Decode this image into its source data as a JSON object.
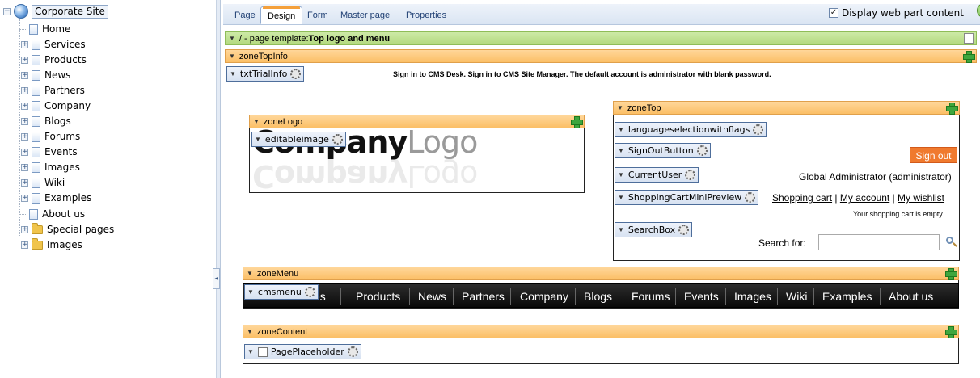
{
  "tree": {
    "root": "Corporate Site",
    "items": [
      {
        "label": "Home"
      },
      {
        "label": "Services"
      },
      {
        "label": "Products"
      },
      {
        "label": "News"
      },
      {
        "label": "Partners"
      },
      {
        "label": "Company"
      },
      {
        "label": "Blogs"
      },
      {
        "label": "Forums"
      },
      {
        "label": "Events"
      },
      {
        "label": "Images"
      },
      {
        "label": "Wiki"
      },
      {
        "label": "Examples"
      },
      {
        "label": "About us"
      },
      {
        "label": "Special pages"
      },
      {
        "label": "Images"
      }
    ]
  },
  "tabs": [
    "Page",
    "Design",
    "Form",
    "Master page",
    "Properties"
  ],
  "display_webpart": "Display web part content",
  "template_bar": {
    "prefix": "/ - page template: ",
    "name": "Top logo and menu"
  },
  "zones": {
    "topinfo": "zoneTopInfo",
    "logo": "zoneLogo",
    "top": "zoneTop",
    "menu": "zoneMenu",
    "content": "zoneContent"
  },
  "webparts": {
    "trialinfo": "txtTrialInfo",
    "editableimage": "editableimage",
    "langflags": "languageselectionwithflags",
    "signout": "SignOutButton",
    "currentuser": "CurrentUser",
    "cart": "ShoppingCartMiniPreview",
    "searchbox": "SearchBox",
    "cmsmenu": "cmsmenu",
    "placeholder": "PagePlaceholder"
  },
  "trial_text": {
    "p1": "Sign in to ",
    "link1": "CMS Desk",
    "p2": ". Sign in to ",
    "link2": "CMS Site Manager",
    "p3": ". The default account is administrator with blank password."
  },
  "logo": {
    "bold": "Company",
    "light": "Logo"
  },
  "signout_label": "Sign out",
  "current_user": "Global Administrator (administrator)",
  "cart_links": {
    "cart": "Shopping cart",
    "sep1": " | ",
    "account": "My account",
    "sep2": " | ",
    "wishlist": "My wishlist",
    "status": "Your shopping cart is empty"
  },
  "search_label": "Search for:",
  "menu": {
    "visible_prefix": "ces",
    "items": [
      "Products",
      "News",
      "Partners",
      "Company",
      "Blogs",
      "Forums",
      "Events",
      "Images",
      "Wiki",
      "Examples",
      "About us"
    ]
  }
}
